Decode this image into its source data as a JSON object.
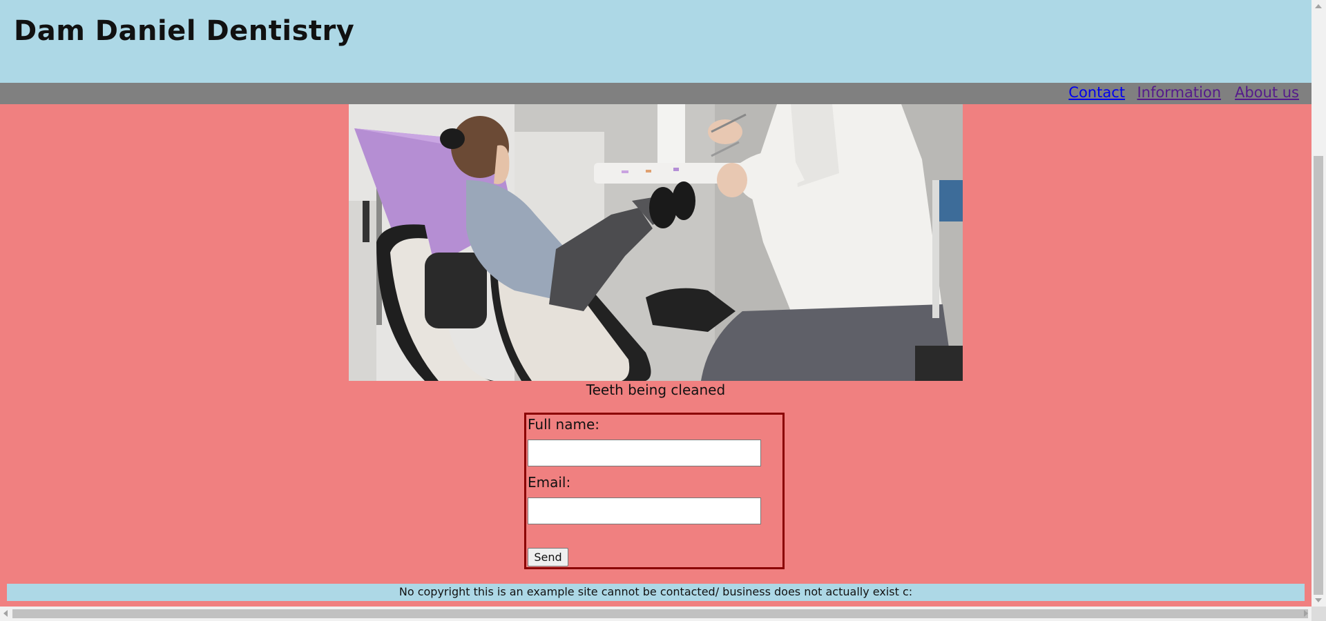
{
  "header": {
    "title": "Dam Daniel Dentistry"
  },
  "nav": {
    "items": [
      {
        "label": "Contact"
      },
      {
        "label": "Information"
      },
      {
        "label": "About us"
      }
    ]
  },
  "hero": {
    "caption": "Teeth being cleaned",
    "image_subject": "dental-cleaning-photo"
  },
  "form": {
    "name_label": "Full name:",
    "name_value": "",
    "email_label": "Email:",
    "email_value": "",
    "submit_label": "Send"
  },
  "footer": {
    "text": "No copyright this is an example site cannot be contacted/ business does not actually exist c:"
  },
  "colors": {
    "header_bg": "#add8e6",
    "nav_bg": "#808080",
    "page_bg": "#f08080",
    "form_border": "#8b0000",
    "link": "#0000ee",
    "link_visited": "#551a8b"
  }
}
